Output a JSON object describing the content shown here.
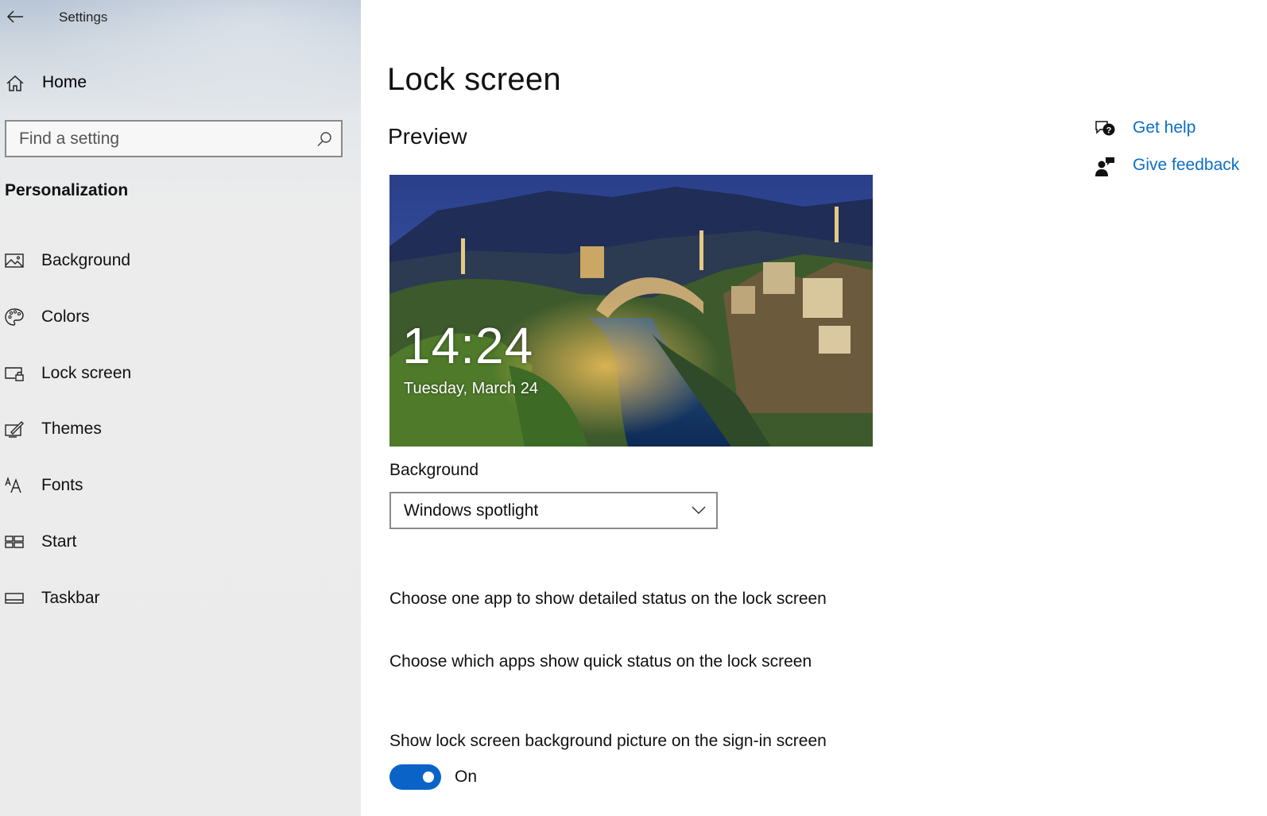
{
  "window": {
    "title": "Settings"
  },
  "sidebar": {
    "home_label": "Home",
    "search_placeholder": "Find a setting",
    "section_title": "Personalization",
    "items": [
      {
        "label": "Background",
        "icon": "picture-icon"
      },
      {
        "label": "Colors",
        "icon": "palette-icon"
      },
      {
        "label": "Lock screen",
        "icon": "lock-screen-icon"
      },
      {
        "label": "Themes",
        "icon": "themes-brush-icon"
      },
      {
        "label": "Fonts",
        "icon": "fonts-icon"
      },
      {
        "label": "Start",
        "icon": "start-tiles-icon"
      },
      {
        "label": "Taskbar",
        "icon": "taskbar-icon"
      }
    ],
    "selected": "Lock screen"
  },
  "main": {
    "title": "Lock screen",
    "preview_heading": "Preview",
    "preview": {
      "time": "14:24",
      "date": "Tuesday, March 24"
    },
    "background_label": "Background",
    "background_value": "Windows spotlight",
    "detailed_status_link": "Choose one app to show detailed status on the lock screen",
    "quick_status_link": "Choose which apps show quick status on the lock screen",
    "signin_label": "Show lock screen background picture on the sign-in screen",
    "signin_toggle_state": "On",
    "signin_toggle_on": true
  },
  "help": {
    "get_help": "Get help",
    "give_feedback": "Give feedback"
  },
  "colors": {
    "accent": "#0a64c8",
    "link": "#0a6fc6"
  }
}
